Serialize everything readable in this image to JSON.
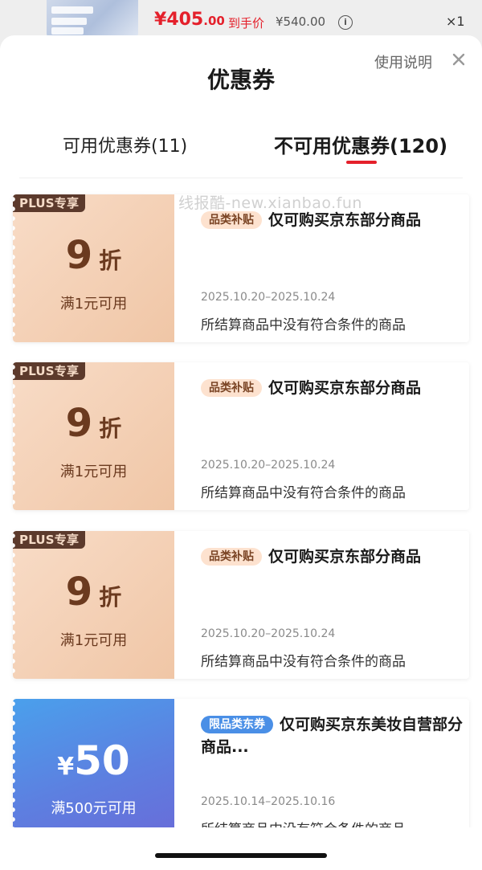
{
  "background_product": {
    "price_symbol": "¥",
    "price_int": "405",
    "price_dec": ".00",
    "hand_price_label": "到手价",
    "original_price": "¥540.00",
    "info_icon": "info-circle-icon",
    "quantity": "×1"
  },
  "sheet": {
    "title": "优惠券",
    "usage_link": "使用说明",
    "close_icon": "close-icon"
  },
  "tabs": [
    {
      "label": "可用优惠券(11)",
      "active": false
    },
    {
      "label": "不可用优惠券(120)",
      "active": true
    }
  ],
  "watermark": "线报酷-new.xianbao.fun",
  "coupons": [
    {
      "badge": "PLUS专享",
      "value": "9",
      "unit": "折",
      "threshold": "满1元可用",
      "tag": "品类补贴",
      "description": "仅可购买京东部分商品",
      "date": "2025.10.20–2025.10.24",
      "reason": "所结算商品中没有符合条件的商品"
    },
    {
      "badge": "PLUS专享",
      "value": "9",
      "unit": "折",
      "threshold": "满1元可用",
      "tag": "品类补贴",
      "description": "仅可购买京东部分商品",
      "date": "2025.10.20–2025.10.24",
      "reason": "所结算商品中没有符合条件的商品"
    },
    {
      "badge": "PLUS专享",
      "value": "9",
      "unit": "折",
      "threshold": "满1元可用",
      "tag": "品类补贴",
      "description": "仅可购买京东部分商品",
      "date": "2025.10.20–2025.10.24",
      "reason": "所结算商品中没有符合条件的商品"
    },
    {
      "currency": "¥",
      "value": "50",
      "threshold": "满500元可用",
      "tag": "限品类东券",
      "description": "仅可购买京东美妆自营部分商品...",
      "date": "2025.10.14–2025.10.16",
      "reason": "所结算商品中没有符合条件的商品"
    }
  ],
  "colors": {
    "accent_red": "#e4202b",
    "coupon_peach": "#f0c6a6",
    "coupon_brown": "#6b3a1f",
    "plus_badge_bg": "#5c3a2c",
    "coupon_blue": "#5d7fe0"
  }
}
